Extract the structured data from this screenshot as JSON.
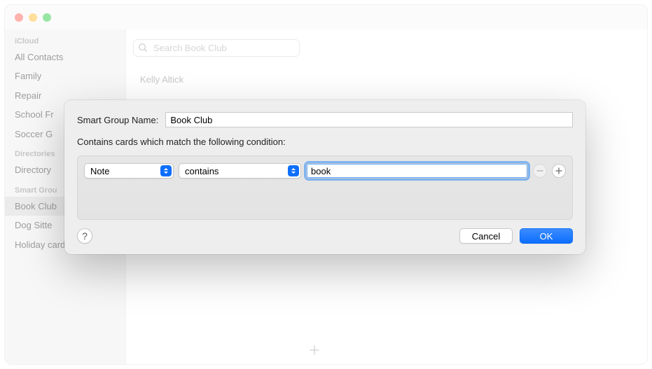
{
  "sidebar": {
    "sections": [
      {
        "header": "iCloud",
        "items": [
          "All Contacts",
          "Family",
          "Repair",
          "School Fr",
          "Soccer G"
        ]
      },
      {
        "header": "Directories",
        "items": [
          "Directory"
        ]
      },
      {
        "header": "Smart Grou",
        "items": [
          "Book Club",
          "Dog Sitte",
          "Holiday cards"
        ]
      }
    ],
    "selected": "Book Club"
  },
  "search": {
    "placeholder": "Search Book Club"
  },
  "contact_preview": {
    "name": "Kelly Altick"
  },
  "sheet": {
    "name_label": "Smart Group Name:",
    "name_value": "Book Club",
    "subtitle": "Contains cards which match the following condition:",
    "condition": {
      "field": "Note",
      "operator": "contains",
      "value": "book"
    },
    "buttons": {
      "help": "?",
      "cancel": "Cancel",
      "ok": "OK"
    }
  }
}
